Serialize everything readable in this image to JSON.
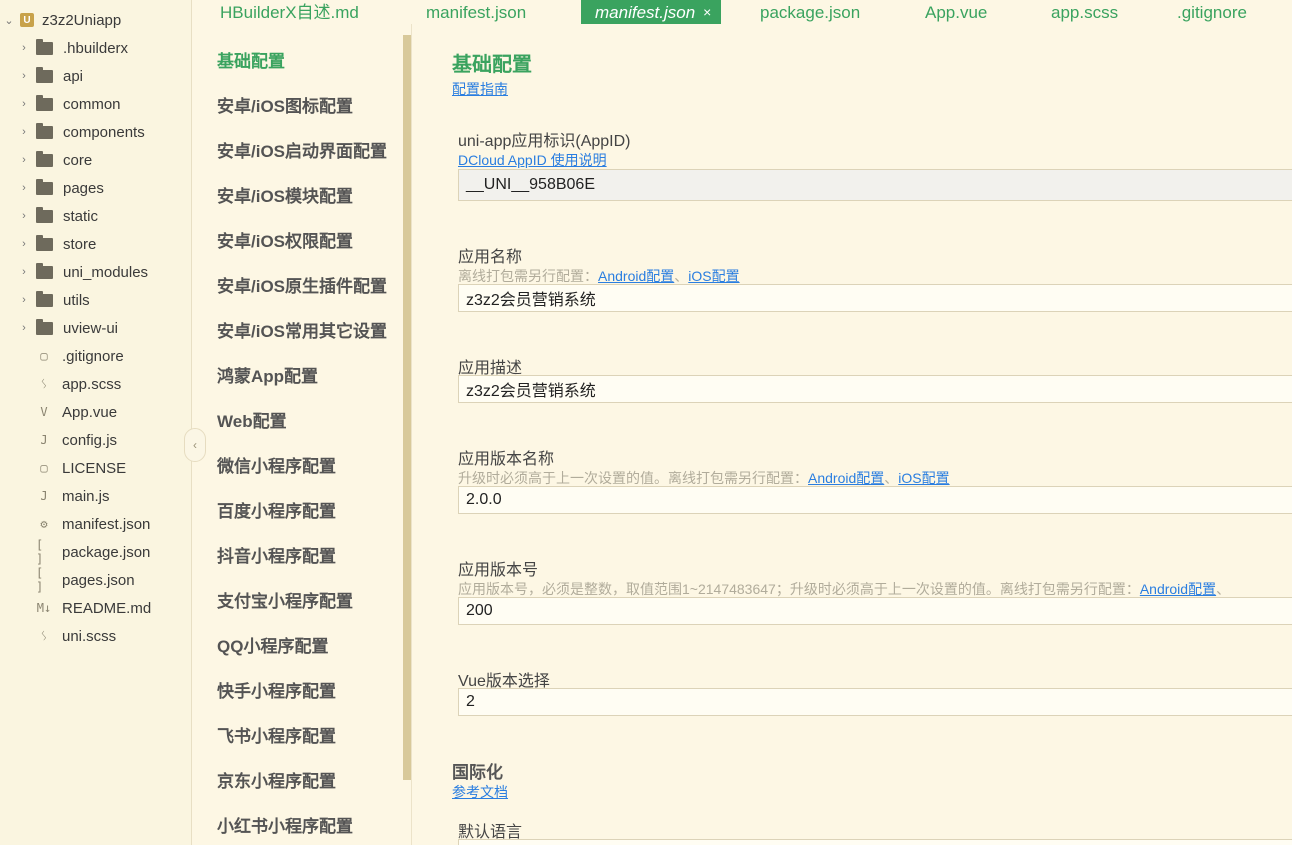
{
  "tree": {
    "project": "z3z2Uniapp",
    "folders": [
      ".hbuilderx",
      "api",
      "common",
      "components",
      "core",
      "pages",
      "static",
      "store",
      "uni_modules",
      "utils",
      "uview-ui"
    ],
    "files": [
      {
        "name": ".gitignore",
        "icon": "file-icon"
      },
      {
        "name": "app.scss",
        "icon": "scss-icon"
      },
      {
        "name": "App.vue",
        "icon": "vue-icon"
      },
      {
        "name": "config.js",
        "icon": "js-icon"
      },
      {
        "name": "LICENSE",
        "icon": "file-icon"
      },
      {
        "name": "main.js",
        "icon": "js-icon"
      },
      {
        "name": "manifest.json",
        "icon": "manifest-icon"
      },
      {
        "name": "package.json",
        "icon": "json-icon"
      },
      {
        "name": "pages.json",
        "icon": "json-icon"
      },
      {
        "name": "README.md",
        "icon": "markdown-icon"
      },
      {
        "name": "uni.scss",
        "icon": "scss-icon"
      }
    ]
  },
  "tabs": [
    "HBuilderX自述.md",
    "manifest.json",
    "manifest.json",
    "package.json",
    "App.vue",
    "app.scss",
    ".gitignore"
  ],
  "active_tab_index": 2,
  "nav": [
    "基础配置",
    "安卓/iOS图标配置",
    "安卓/iOS启动界面配置",
    "安卓/iOS模块配置",
    "安卓/iOS权限配置",
    "安卓/iOS原生插件配置",
    "安卓/iOS常用其它设置",
    "鸿蒙App配置",
    "Web配置",
    "微信小程序配置",
    "百度小程序配置",
    "抖音小程序配置",
    "支付宝小程序配置",
    "QQ小程序配置",
    "快手小程序配置",
    "飞书小程序配置",
    "京东小程序配置",
    "小红书小程序配置"
  ],
  "main": {
    "title": "基础配置",
    "guide_link": "配置指南",
    "appid": {
      "label": "uni-app应用标识(AppID)",
      "help_link": "DCloud AppID 使用说明",
      "value": "__UNI__958B06E"
    },
    "app_name": {
      "label": "应用名称",
      "hint": "离线打包需另行配置：",
      "android_link": "Android配置",
      "sep": "、",
      "ios_link": "iOS配置",
      "value": "z3z2会员营销系统"
    },
    "app_desc": {
      "label": "应用描述",
      "value": "z3z2会员营销系统"
    },
    "version_name": {
      "label": "应用版本名称",
      "hint": "升级时必须高于上一次设置的值。离线打包需另行配置：",
      "android_link": "Android配置",
      "sep": "、",
      "ios_link": "iOS配置",
      "value": "2.0.0"
    },
    "version_code": {
      "label": "应用版本号",
      "hint": "应用版本号，必须是整数，取值范围1~2147483647；升级时必须高于上一次设置的值。离线打包需另行配置：",
      "android_link": "Android配置",
      "sep": "、",
      "value": "200"
    },
    "vue_version": {
      "label": "Vue版本选择",
      "value": "2"
    },
    "i18n": {
      "title": "国际化",
      "doc_link": "参考文档",
      "default_lang_label": "默认语言"
    }
  }
}
